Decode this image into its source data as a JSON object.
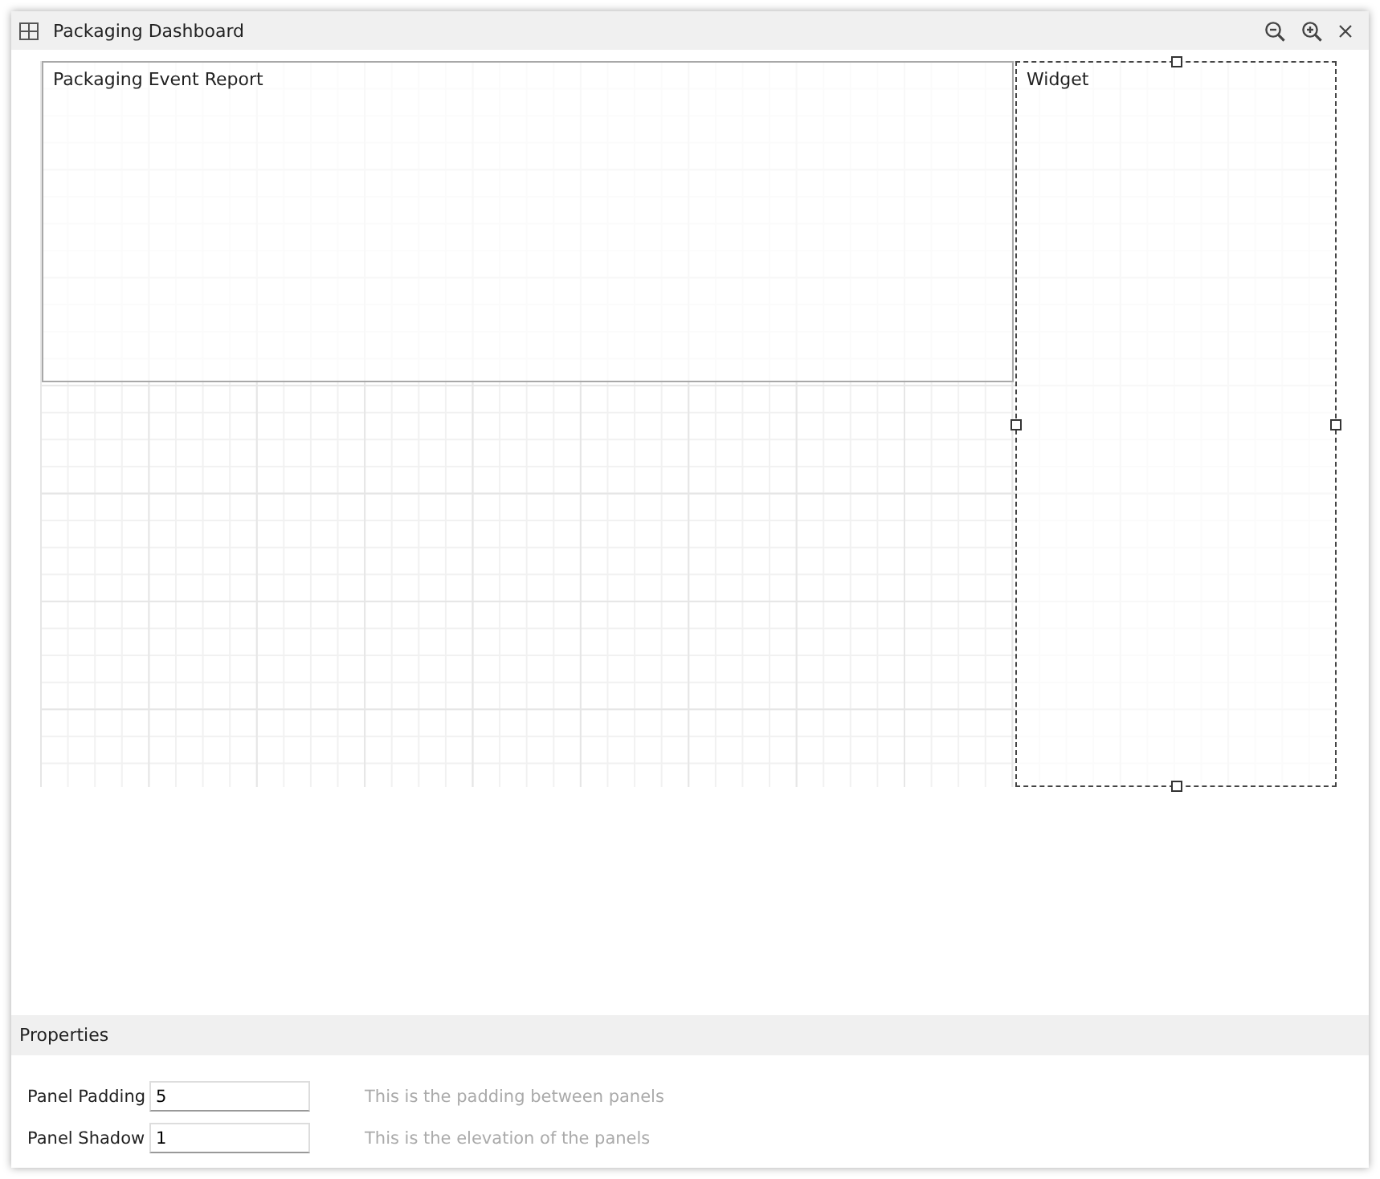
{
  "window": {
    "title": "Packaging Dashboard"
  },
  "panels": [
    {
      "title": "Packaging Event Report",
      "selected": false
    },
    {
      "title": "Widget",
      "selected": true
    }
  ],
  "properties": {
    "title": "Properties",
    "rows": [
      {
        "label": "Panel Padding",
        "value": "5",
        "description": "This is the padding between panels"
      },
      {
        "label": "Panel Shadow",
        "value": "1",
        "description": "This is the elevation of the panels"
      }
    ]
  }
}
